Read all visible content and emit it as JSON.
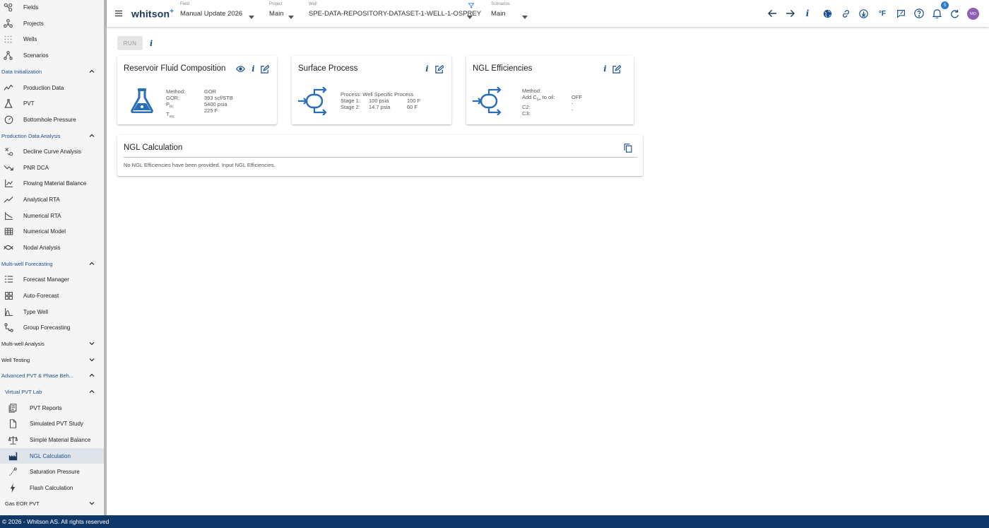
{
  "app": {
    "logo": "whitson",
    "logo_sup": "+"
  },
  "sidebar": {
    "top_items": [
      {
        "label": "Fields",
        "icon": "fields-icon"
      },
      {
        "label": "Projects",
        "icon": "projects-icon"
      },
      {
        "label": "Wells",
        "icon": "wells-icon"
      },
      {
        "label": "Scenarios",
        "icon": "scenarios-icon"
      }
    ],
    "sections": {
      "data_init": "Data Initialization",
      "prod_analysis": "Production Data Analysis",
      "mw_forecasting": "Multi-well Forecasting",
      "mw_analysis": "Multi-well Analysis",
      "well_testing": "Well Testing",
      "adv_pvt": "Advanced PVT & Phase Beh...",
      "virtual_pvt": "Virtual PVT Lab",
      "gas_eor": "Gas EOR PVT"
    },
    "data_init_items": [
      "Production Data",
      "PVT",
      "Bottomhole Pressure"
    ],
    "prod_items": [
      "Decline Curve Analysis",
      "PNR DCA",
      "Flowing Material Balance",
      "Analytical RTA",
      "Numerical RTA",
      "Numerical Model",
      "Nodal Analysis"
    ],
    "forecast_items": [
      "Forecast Manager",
      "Auto-Forecast",
      "Type Well",
      "Group Forecasting"
    ],
    "vpvt_items": [
      "PVT Reports",
      "Simulated PVT Study",
      "Simple Material Balance",
      "NGL Calculation",
      "Saturation Pressure",
      "Flash Calculation"
    ],
    "active_item": "NGL Calculation"
  },
  "topbar": {
    "field": {
      "label": "Field",
      "value": "Manual Update 2026"
    },
    "project": {
      "label": "Project",
      "value": "Main"
    },
    "well": {
      "label": "Well",
      "value": "SPE-DATA-REPOSITORY-DATASET-1-WELL-1-OSPREY"
    },
    "scenarios": {
      "label": "Scenarios",
      "value": "Main"
    },
    "unit_label": "°F",
    "notification_count": "5",
    "avatar_initials": "MO"
  },
  "main": {
    "run_label": "RUN",
    "info_label": "i",
    "reservoir_card": {
      "title": "Reservoir Fluid Composition",
      "keys": [
        "Method:",
        "GOR:",
        "P",
        "T"
      ],
      "key_subs": [
        "",
        "",
        "Ri:",
        "res:"
      ],
      "values": [
        "GOR",
        "393 scf/STB",
        "5400 psia",
        "225 F"
      ]
    },
    "surface_card": {
      "title": "Surface Process",
      "process_line": "Process: Well Specific Process",
      "stages": [
        {
          "name": "Stage 1:",
          "pressure": "100 psia",
          "temp": "100 F"
        },
        {
          "name": "Stage 2:",
          "pressure": "14.7 psia",
          "temp": "60 F"
        }
      ]
    },
    "ngl_eff_card": {
      "title": "NGL Efficiencies",
      "keys": [
        "Method:",
        "Add C",
        "C2:",
        "C3:"
      ],
      "add_sub": "5+",
      "add_suffix": " to oil:",
      "values": [
        "",
        "OFF",
        "-",
        "-"
      ]
    },
    "ngl_calc_card": {
      "title": "NGL Calculation",
      "message": "No NGL Efficiencies have been provided. Input NGL Efficiencies."
    }
  },
  "footer": {
    "text": "© 2026 - Whitson AS. All rights reserved"
  },
  "colors": {
    "accent": "#1c4f8f",
    "footer_bg": "#0f3868",
    "active_bg": "#dfe3ea",
    "avatar": "#8e5fb5"
  }
}
